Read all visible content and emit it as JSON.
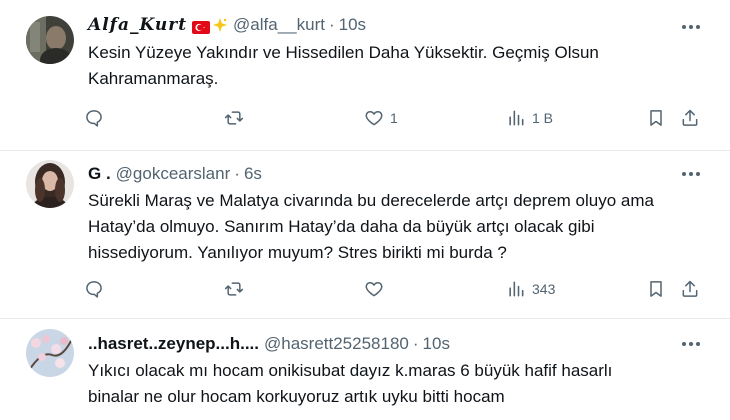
{
  "tweets": [
    {
      "display_name": "Alfa_Kurt",
      "handle": "@alfa__kurt",
      "separator": "·",
      "time": "10s",
      "text_lines": [
        "Kesin Yüzeye Yakındır ve Hissedilen Daha Yüksektir. Geçmiş Olsun",
        "Kahramanmaraş."
      ],
      "likes": "1",
      "views": "1 B",
      "badges": [
        "turkey-flag",
        "sparkle-star"
      ]
    },
    {
      "display_name": "G .",
      "handle": "@gokcearslanr",
      "separator": "·",
      "time": "6s",
      "text_lines": [
        "Sürekli Maraş ve Malatya civarında bu derecelerde artçı deprem oluyo ama",
        "Hatay’da olmuyo. Sanırım Hatay’da daha da büyük artçı olacak gibi",
        "hissediyorum. Yanılıyor muyum? Stres birikti mi burda ?"
      ],
      "likes": "",
      "views": "343"
    },
    {
      "display_name": "..hasret..zeynep...h....",
      "handle": "@hasrett25258180",
      "separator": "·",
      "time": "10s",
      "text_lines": [
        "Yıkıcı olacak mı hocam onikisubat dayız k.maras 6 büyük hafif hasarlı",
        "binalar ne olur hocam korkuyoruz artık uyku bitti hocam"
      ]
    }
  ],
  "colors": {
    "secondary_text": "#536471",
    "primary_text": "#0f1419",
    "divider": "#e6e9eb"
  }
}
